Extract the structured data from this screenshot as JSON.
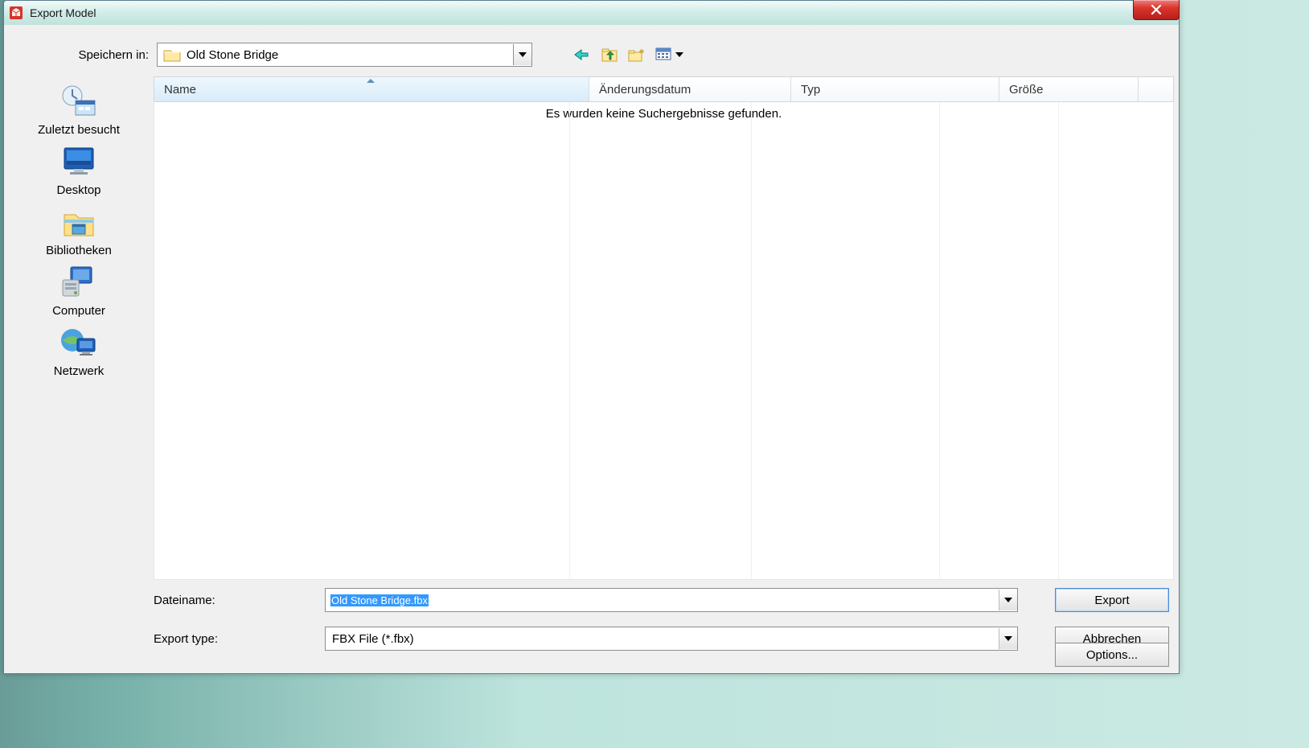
{
  "window": {
    "title": "Export Model"
  },
  "top": {
    "save_in_label": "Speichern in:",
    "folder_name": "Old Stone Bridge"
  },
  "places": [
    {
      "label": "Zuletzt besucht"
    },
    {
      "label": "Desktop"
    },
    {
      "label": "Bibliotheken"
    },
    {
      "label": "Computer"
    },
    {
      "label": "Netzwerk"
    }
  ],
  "columns": {
    "name": "Name",
    "modified": "Änderungsdatum",
    "type": "Typ",
    "size": "Größe"
  },
  "list": {
    "empty": "Es wurden keine Suchergebnisse gefunden."
  },
  "bottom": {
    "filename_label": "Dateiname:",
    "filename_value": "Old Stone Bridge.fbx",
    "type_label": "Export type:",
    "type_value": "FBX File (*.fbx)",
    "export": "Export",
    "cancel": "Abbrechen",
    "options": "Options..."
  }
}
